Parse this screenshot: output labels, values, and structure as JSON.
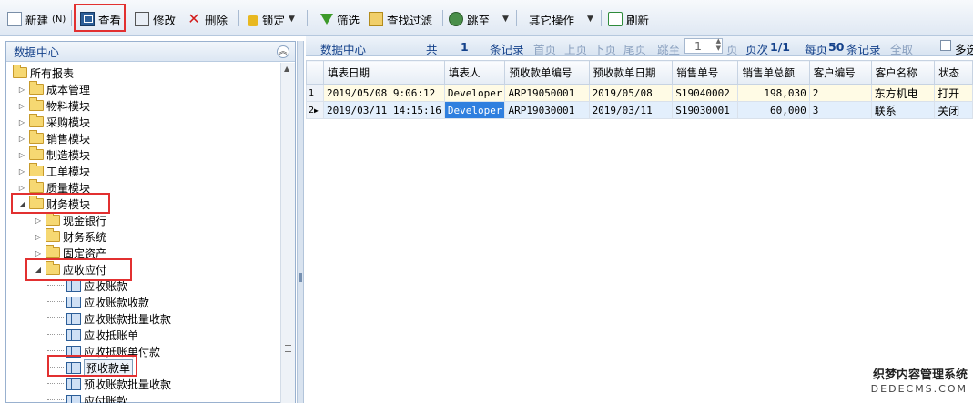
{
  "toolbar": {
    "new_label": "新建",
    "new_shortcut": "(N)",
    "view_label": "查看",
    "edit_label": "修改",
    "delete_label": "删除",
    "lock_label": "锁定",
    "filter_label": "筛选",
    "find_filter_label": "查找过滤",
    "jump_label": "跳至",
    "other_label": "其它操作",
    "refresh_label": "刷新"
  },
  "left_panel": {
    "title": "数据中心",
    "tree": [
      {
        "label": "所有报表",
        "level": 0,
        "type": "folder",
        "expanded": true
      },
      {
        "label": "成本管理",
        "level": 1,
        "type": "folder"
      },
      {
        "label": "物料模块",
        "level": 1,
        "type": "folder"
      },
      {
        "label": "采购模块",
        "level": 1,
        "type": "folder"
      },
      {
        "label": "销售模块",
        "level": 1,
        "type": "folder"
      },
      {
        "label": "制造模块",
        "level": 1,
        "type": "folder"
      },
      {
        "label": "工单模块",
        "level": 1,
        "type": "folder"
      },
      {
        "label": "质量模块",
        "level": 1,
        "type": "folder"
      },
      {
        "label": "财务模块",
        "level": 1,
        "type": "folder",
        "expanded": true
      },
      {
        "label": "现金银行",
        "level": 2,
        "type": "folder"
      },
      {
        "label": "财务系统",
        "level": 2,
        "type": "folder"
      },
      {
        "label": "固定资产",
        "level": 2,
        "type": "folder"
      },
      {
        "label": "应收应付",
        "level": 2,
        "type": "folder",
        "expanded": true
      },
      {
        "label": "应收账款",
        "level": 3,
        "type": "report"
      },
      {
        "label": "应收账款收款",
        "level": 3,
        "type": "report"
      },
      {
        "label": "应收账款批量收款",
        "level": 3,
        "type": "report"
      },
      {
        "label": "应收抵账单",
        "level": 3,
        "type": "report"
      },
      {
        "label": "应收抵账单付款",
        "level": 3,
        "type": "report"
      },
      {
        "label": "预收款单",
        "level": 3,
        "type": "report",
        "selected": true
      },
      {
        "label": "预收账款批量收款",
        "level": 3,
        "type": "report"
      },
      {
        "label": "应付账款",
        "level": 3,
        "type": "report"
      }
    ]
  },
  "pager": {
    "title": "数据中心",
    "total_prefix": "共",
    "total_count": "1",
    "total_suffix": "条记录",
    "first": "首页",
    "prev": "上页",
    "next": "下页",
    "last": "尾页",
    "jump": "跳至",
    "page_input": "1",
    "page_unit": "页",
    "page_info_label": "页次",
    "page_info_value": "1/1",
    "per_page_prefix": "每页",
    "per_page_value": "50",
    "per_page_suffix": "条记录",
    "all": "全取",
    "multi_select": "多选"
  },
  "grid": {
    "columns": [
      "填表日期",
      "填表人",
      "预收款单编号",
      "预收款单日期",
      "销售单号",
      "销售单总额",
      "客户编号",
      "客户名称",
      "状态"
    ],
    "rows": [
      {
        "rownum": "1",
        "cells": [
          "2019/05/08 9:06:12",
          "Developer",
          "ARP19050001",
          "2019/05/08",
          "S19040002",
          "198,030",
          "2",
          "东方机电",
          "打开"
        ]
      },
      {
        "rownum": "2",
        "cells": [
          "2019/03/11 14:15:16",
          "Developer",
          "ARP19030001",
          "2019/03/11",
          "S19030001",
          "60,000",
          "3",
          "联系",
          "关闭"
        ]
      }
    ]
  },
  "watermark": {
    "line1": "织梦内容管理系统",
    "line2": "DEDECMS.COM"
  },
  "colors": {
    "highlight_red": "#e23030",
    "header_blue": "#15428b",
    "selected_cell": "#2f7fdf"
  }
}
